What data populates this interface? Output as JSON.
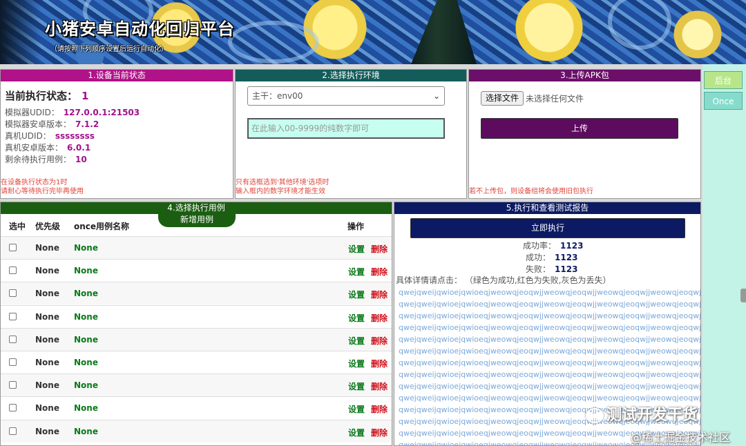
{
  "banner": {
    "title": "小猪安卓自动化回归平台",
    "subtitle": "（请按照下列顺序设置后运行自动化）"
  },
  "panel1": {
    "header": "1.设备当前状态",
    "status_label": "当前执行状态：",
    "status_value": "1",
    "fields": [
      {
        "label": "模拟器UDID：",
        "value": "127.0.0.1:21503"
      },
      {
        "label": "模拟器安卓版本：",
        "value": "7.1.2"
      },
      {
        "label": "真机UDID：",
        "value": "ssssssss"
      },
      {
        "label": "真机安卓版本：",
        "value": "6.0.1"
      },
      {
        "label": "剩余待执行用例：",
        "value": "10"
      }
    ],
    "note1": "在设备执行状态为1时",
    "note2": "请耐心等待执行完毕再使用"
  },
  "panel2": {
    "header": "2.选择执行环境",
    "select_value": "主干：env00",
    "input_placeholder": "在此输入00-9999的纯数字即可",
    "note1": "只有选框选到'其他环境'选项时",
    "note2": "输入框内的数字环境才能生效"
  },
  "panel3": {
    "header": "3.上传APK包",
    "file_button": "选择文件",
    "file_status": "未选择任何文件",
    "upload_button": "上传",
    "note": "若不上传包，则设备组将会使用旧包执行"
  },
  "side": {
    "backend": "后台",
    "once": "Once"
  },
  "panel4": {
    "header": "4.选择执行用例",
    "add_button": "新增用例",
    "columns": {
      "select": "选中",
      "priority": "优先级",
      "name": "once用例名称",
      "action": "操作"
    },
    "rows": [
      {
        "priority": "None",
        "name": "None",
        "set": "设置",
        "del": "删除"
      },
      {
        "priority": "None",
        "name": "None",
        "set": "设置",
        "del": "删除"
      },
      {
        "priority": "None",
        "name": "None",
        "set": "设置",
        "del": "删除"
      },
      {
        "priority": "None",
        "name": "None",
        "set": "设置",
        "del": "删除"
      },
      {
        "priority": "None",
        "name": "None",
        "set": "设置",
        "del": "删除"
      },
      {
        "priority": "None",
        "name": "None",
        "set": "设置",
        "del": "删除"
      },
      {
        "priority": "None",
        "name": "None",
        "set": "设置",
        "del": "删除"
      },
      {
        "priority": "None",
        "name": "None",
        "set": "设置",
        "del": "删除"
      },
      {
        "priority": "None",
        "name": "None",
        "set": "设置",
        "del": "删除"
      }
    ]
  },
  "panel5": {
    "header": "5.执行和查看测试报告",
    "run_button": "立即执行",
    "success_rate_label": "成功率：",
    "success_rate": "1123",
    "success_label": "成功：",
    "success": "1123",
    "fail_label": "失败：",
    "fail": "1123",
    "detail": "具体详情请点击：  （绿色为成功,红色为失败,灰色为丢失）",
    "log_lines": [
      "qwejqweijqwioejqwioeqjweowqjeoqwjjweowqjeoqwjjweowqjeoqwjjweowqjeoqwjeoiqwjeoiqwjeoi",
      "qwejqweijqwioejqwioeqjweowqjeoqwjjweowqjeoqwjjweowqjeoqwjjweowqjeoqwjeoiqwjeoiqwjeoi",
      "qwejqweijqwioejqwioeqjweowqjeoqwjjweowqjeoqwjjweowqjeoqwjjweowqjeoqwjeoiqwjeoiqwjeoi",
      "qwejqweijqwioejqwioeqjweowqjeoqwjjweowqjeoqwjjweowqjeoqwjjweowqjeoqwjeoiqwjeoiqwjeoi",
      "qwejqweijqwioejqwioeqjweowqjeoqwjjweowqjeoqwjjweowqjeoqwjjweowqjeoqwjeoiqwjeoiqwjeoi",
      "qwejqweijqwioejqwioeqjweowqjeoqwjjweowqjeoqwjjweowqjeoqwjjweowqjeoqwjeoiqwjeoiqwjeoi",
      "qwejqweijqwioejqwioeqjweowqjeoqwjjweowqjeoqwjjweowqjeoqwjjweowqjeoqwjeoiqwjeoiqwjeoi",
      "qwejqweijqwioejqwioeqjweowqjeoqwjjweowqjeoqwjjweowqjeoqwjjweowqjeoqwjeoiqwjeoiqwjeoi",
      "qwejqweijqwioejqwioeqjweowqjeoqwjjweowqjeoqwjjweowqjeoqwjjweowqjeoqwjeoiqwjeoiqwjeoi",
      "qwejqweijqwioejqwioeqjweowqjeoqwjjweowqjeoqwjjweowqjeoqwjjweowqjeoqwjeoiqwjeoiqwjeoi",
      "qwejqweijqwioejqwioeqjweowqjeoqwjjweowqjeoqwjjweowqjeoqwjjweowqjeoqwjeoiqwjeoiqwjeoi",
      "qwejqweijqwioejqwioeqjweowqjeoqwjjweowqjeoqwjjweowqjeoqwjjweowqjeoqwjeoiqwjeoiqwjeoi",
      "qwejqweijqwioejqwioeqjweowqjeoqwjjweowqjeoqwjjweowqjeoqwjjweowqjeoqwjeoiqwjeoiqwjeoi",
      "qwejqweijqwioejqwioeqjweowqjeoqwjjweowqjeoqwjjweowqjeoqwjjweowqjeoqwjeoiqwjeoiqwjeoi"
    ]
  },
  "watermark": {
    "line1": "测试开发干货",
    "line2": "@稀土掘金技术社区"
  },
  "colors": {
    "panel1": "#b01289",
    "panel2": "#135c5a",
    "panel3": "#6b0f6a",
    "panel4": "#1b5e11",
    "panel5": "#0c1a63",
    "side_bg": "#c3f3e6",
    "backend_btn": "#b7e68a",
    "once_btn": "#86dccc"
  }
}
